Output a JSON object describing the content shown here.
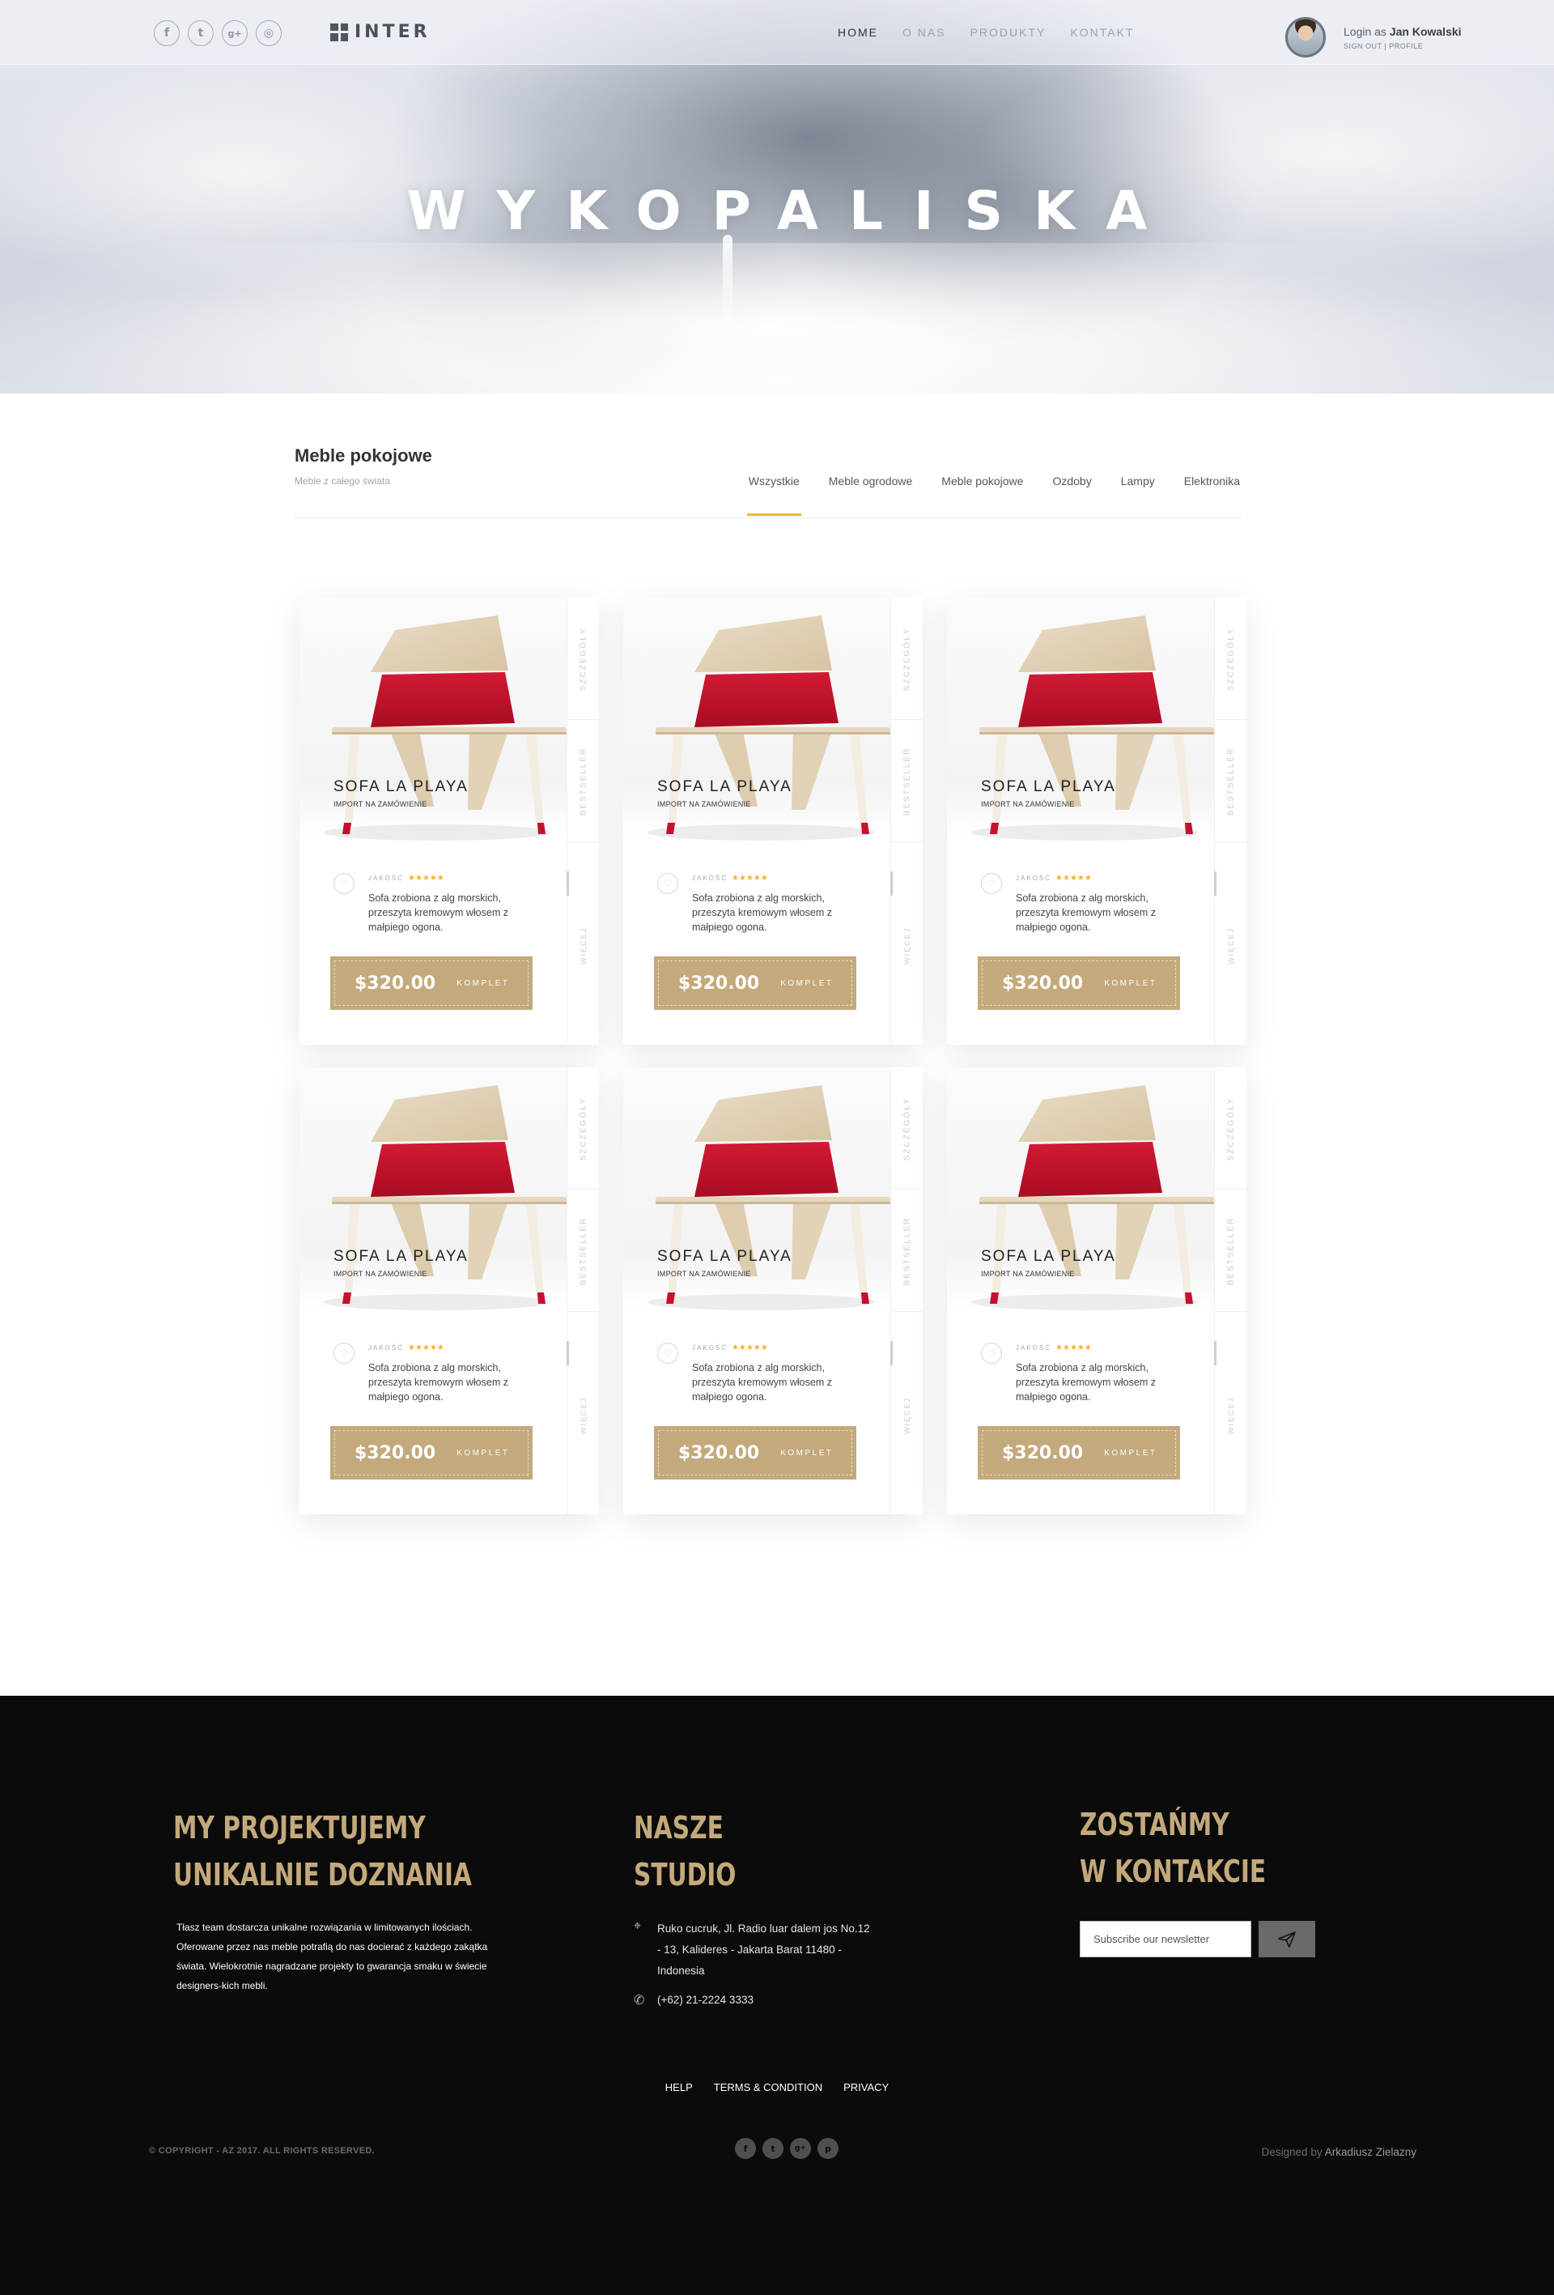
{
  "hero": {
    "title": "WYKOPALISKA"
  },
  "header": {
    "social": [
      {
        "glyph": "f",
        "icon": "facebook-icon"
      },
      {
        "glyph": "t",
        "icon": "twitter-icon"
      },
      {
        "glyph": "g+",
        "icon": "google-plus-icon"
      },
      {
        "glyph": "◎",
        "icon": "instagram-icon"
      }
    ],
    "logo_text": "INTER",
    "nav": [
      "HOME",
      "O NAS",
      "PRODUKTY",
      "KONTAKT"
    ],
    "nav_active": "HOME",
    "user": {
      "login_prefix": "Login as",
      "name": "Jan Kowalski",
      "sign_out": "SIGN OUT",
      "separator": "|",
      "profile": "PROFILE"
    }
  },
  "category": {
    "title": "Meble pokojowe",
    "subtitle": "Meble z całego świata",
    "tabs": [
      "Wszystkie",
      "Meble ogrodowe",
      "Meble pokojowe",
      "Ozdoby",
      "Lampy",
      "Elektronika"
    ],
    "active_tab": "Wszystkie"
  },
  "products": [
    {
      "name": "SOFA LA PLAYA",
      "tag": "IMPORT NA ZAMÓWIENIE",
      "quality_label": "JAKOŚĆ",
      "stars": "★★★★★",
      "description": "Sofa zrobiona z alg morskich, przeszyta kremowym włosem z małpiego ogona.",
      "price": "$320.00",
      "button_label": "KOMPLET",
      "side_labels": [
        "SZCZEGÓŁY",
        "BESTSELLER",
        "WIĘCEJ"
      ]
    },
    {
      "name": "SOFA LA PLAYA",
      "tag": "IMPORT NA ZAMÓWIENIE",
      "quality_label": "JAKOŚĆ",
      "stars": "★★★★★",
      "description": "Sofa zrobiona z alg morskich, przeszyta kremowym włosem z małpiego ogona.",
      "price": "$320.00",
      "button_label": "KOMPLET",
      "side_labels": [
        "SZCZEGÓŁY",
        "BESTSELLER",
        "WIĘCEJ"
      ]
    },
    {
      "name": "SOFA LA PLAYA",
      "tag": "IMPORT NA ZAMÓWIENIE",
      "quality_label": "JAKOŚĆ",
      "stars": "★★★★★",
      "description": "Sofa zrobiona z alg morskich, przeszyta kremowym włosem z małpiego ogona.",
      "price": "$320.00",
      "button_label": "KOMPLET",
      "side_labels": [
        "SZCZEGÓŁY",
        "BESTSELLER",
        "WIĘCEJ"
      ]
    },
    {
      "name": "SOFA LA PLAYA",
      "tag": "IMPORT NA ZAMÓWIENIE",
      "quality_label": "JAKOŚĆ",
      "stars": "★★★★★",
      "description": "Sofa zrobiona z alg morskich, przeszyta kremowym włosem z małpiego ogona.",
      "price": "$320.00",
      "button_label": "KOMPLET",
      "side_labels": [
        "SZCZEGÓŁY",
        "BESTSELLER",
        "WIĘCEJ"
      ]
    },
    {
      "name": "SOFA LA PLAYA",
      "tag": "IMPORT NA ZAMÓWIENIE",
      "quality_label": "JAKOŚĆ",
      "stars": "★★★★★",
      "description": "Sofa zrobiona z alg morskich, przeszyta kremowym włosem z małpiego ogona.",
      "price": "$320.00",
      "button_label": "KOMPLET",
      "side_labels": [
        "SZCZEGÓŁY",
        "BESTSELLER",
        "WIĘCEJ"
      ]
    },
    {
      "name": "SOFA LA PLAYA",
      "tag": "IMPORT NA ZAMÓWIENIE",
      "quality_label": "JAKOŚĆ",
      "stars": "★★★★★",
      "description": "Sofa zrobiona z alg morskich, przeszyta kremowym włosem z małpiego ogona.",
      "price": "$320.00",
      "button_label": "KOMPLET",
      "side_labels": [
        "SZCZEGÓŁY",
        "BESTSELLER",
        "WIĘCEJ"
      ]
    }
  ],
  "footer": {
    "col1": {
      "heading_line1": "MY PROJEKTUJEMY",
      "heading_line2": "UNIKALNIE DOZNANIA",
      "text": "Tłasz team dostarcza unikalne rozwiązania w limitowanych ilościach. Oferowane przez nas meble potrafią do nas docierać z każdego zakątka świata. Wielokrotnie nagradzane projekty to gwarancja smaku w świecie designers-kich mebli."
    },
    "col2": {
      "heading_line1": "NASZE",
      "heading_line2": "STUDIO",
      "address": "Ruko cucruk, Jl. Radio luar dalem jos No.12 - 13, Kalideres - Jakarta Barat 11480 - Indonesia",
      "phone": "(+62) 21-2224 3333"
    },
    "col3": {
      "heading_line1": "ZOSTAŃMY",
      "heading_line2": "W KONTAKCIE",
      "newsletter_placeholder": "Subscribe our newsletter"
    },
    "links": [
      "HELP",
      "TERMS & CONDITION",
      "PRIVACY"
    ],
    "copyright": "© COPYRIGHT - AZ 2017. ALL RIGHTS RESERVED.",
    "social": [
      {
        "glyph": "f",
        "icon": "facebook-icon"
      },
      {
        "glyph": "t",
        "icon": "twitter-icon"
      },
      {
        "glyph": "g+",
        "icon": "google-plus-icon"
      },
      {
        "glyph": "p",
        "icon": "pinterest-icon"
      }
    ],
    "designed_prefix": "Designed by",
    "designer": "Arkadiusz Zielazny"
  },
  "colors": {
    "accent_gold": "#c3a97b",
    "tab_underline": "#f0ba2c",
    "star": "#f3b42a",
    "footer_bg": "#0b0b0b",
    "chair_red": "#c8102e"
  }
}
